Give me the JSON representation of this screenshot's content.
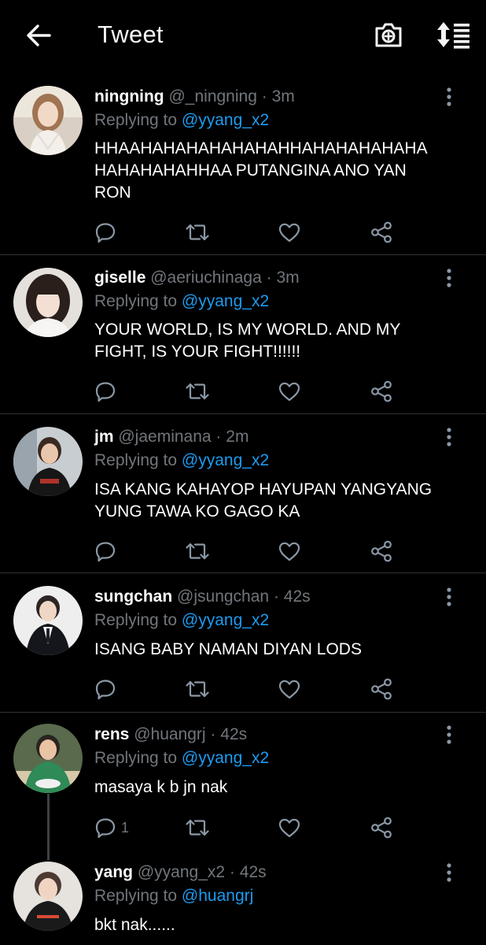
{
  "header": {
    "title": "Tweet"
  },
  "tweets": [
    {
      "name": "ningning",
      "handle": "@_ningning",
      "time": "3m",
      "replying_label": "Replying to",
      "replying_to": "@yyang_x2",
      "text": "HHAAHAHAHAHAHAHAHHAHAHAHAHAHA\nHAHAHAHAHHAA PUTANGINA ANO YAN\nRON",
      "reply_count": ""
    },
    {
      "name": "giselle",
      "handle": "@aeriuchinaga",
      "time": "3m",
      "replying_label": "Replying to",
      "replying_to": "@yyang_x2",
      "text": "YOUR WORLD, IS MY WORLD. AND MY\nFIGHT, IS YOUR FIGHT!!!!!!",
      "reply_count": ""
    },
    {
      "name": "jm",
      "handle": "@jaeminana",
      "time": "2m",
      "replying_label": "Replying to",
      "replying_to": "@yyang_x2",
      "text": "ISA KANG KAHAYOP HAYUPAN YANGYANG\nYUNG TAWA KO GAGO KA",
      "reply_count": ""
    },
    {
      "name": "sungchan",
      "handle": "@jsungchan",
      "time": "42s",
      "replying_label": "Replying to",
      "replying_to": "@yyang_x2",
      "text": "ISANG BABY NAMAN DIYAN LODS",
      "reply_count": ""
    },
    {
      "name": "rens",
      "handle": "@huangrj",
      "time": "42s",
      "replying_label": "Replying to",
      "replying_to": "@yyang_x2",
      "text": "masaya k b jn nak",
      "reply_count": "1"
    },
    {
      "name": "yang",
      "handle": "@yyang_x2",
      "time": "42s",
      "replying_label": "Replying to",
      "replying_to": "@huangrj",
      "text": "bkt nak......",
      "reply_count": ""
    }
  ],
  "icons": {
    "back": "arrow-left-icon",
    "camera": "camera-add-icon",
    "sort": "sort-icon",
    "more": "more-vertical-icon",
    "reply": "reply-icon",
    "retweet": "retweet-icon",
    "like": "heart-icon",
    "share": "share-icon"
  },
  "colors": {
    "background": "#000000",
    "text": "#ffffff",
    "secondary": "#71767b",
    "link": "#1d9bf0",
    "divider": "#2f3336"
  },
  "separator": "·"
}
